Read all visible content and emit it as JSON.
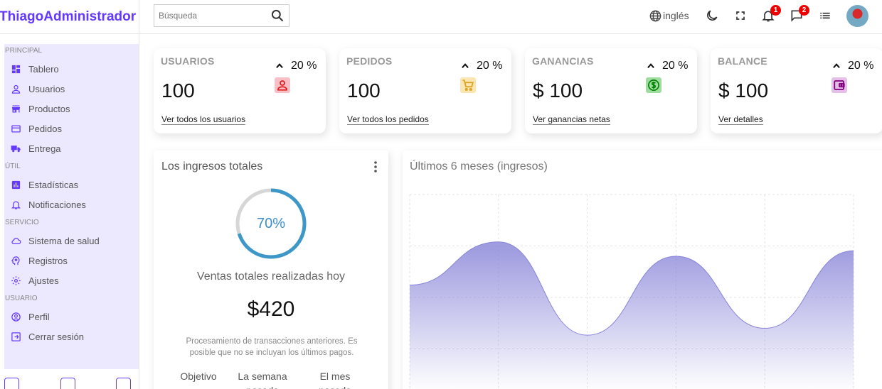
{
  "app": {
    "logo": "ThiagoAdministrador"
  },
  "search": {
    "placeholder": "Búsqueda"
  },
  "topbar": {
    "language": "inglés",
    "notifications_count": "1",
    "messages_count": "2"
  },
  "sidebar": {
    "sections": [
      {
        "title": "PRINCIPAL",
        "items": [
          {
            "label": "Tablero",
            "icon": "dashboard-icon"
          },
          {
            "label": "Usuarios",
            "icon": "user-icon"
          },
          {
            "label": "Productos",
            "icon": "store-icon"
          },
          {
            "label": "Pedidos",
            "icon": "credit-card-icon"
          },
          {
            "label": "Entrega",
            "icon": "truck-icon"
          }
        ]
      },
      {
        "title": "ÚTIL",
        "items": [
          {
            "label": "Estadísticas",
            "icon": "bar-chart-icon"
          },
          {
            "label": "Notificaciones",
            "icon": "bell-icon"
          }
        ]
      },
      {
        "title": "SERVICIO",
        "items": [
          {
            "label": "Sistema de salud",
            "icon": "cloud-icon"
          },
          {
            "label": "Registros",
            "icon": "psychology-icon"
          },
          {
            "label": "Ajustes",
            "icon": "settings-icon"
          }
        ]
      },
      {
        "title": "USUARIO",
        "items": [
          {
            "label": "Perfil",
            "icon": "account-circle-icon"
          },
          {
            "label": "Cerrar sesión",
            "icon": "logout-icon"
          }
        ]
      }
    ],
    "color_options": [
      "#f6f6fb",
      "#333333",
      "#00008b"
    ]
  },
  "widgets": [
    {
      "title": "USUARIOS",
      "value": "100",
      "link": "Ver todos los usuarios",
      "percent": "20 %",
      "icon": "user-icon",
      "icon_color": "#e02020",
      "icon_bg": "#f8c0c6"
    },
    {
      "title": "PEDIDOS",
      "value": "100",
      "link": "Ver todos los pedidos",
      "percent": "20 %",
      "icon": "cart-icon",
      "icon_color": "#daa520",
      "icon_bg": "#fbe5b2"
    },
    {
      "title": "GANANCIAS",
      "value": "$ 100",
      "link": "Ver ganancias netas",
      "percent": "20 %",
      "icon": "dollar-icon",
      "icon_color": "#008000",
      "icon_bg": "#9fdc9f"
    },
    {
      "title": "BALANCE",
      "value": "$ 100",
      "link": "Ver detalles",
      "percent": "20 %",
      "icon": "wallet-icon",
      "icon_color": "#800080",
      "icon_bg": "#e6bfe6"
    }
  ],
  "featured": {
    "title": "Los ingresos totales",
    "progress_percent": 70,
    "progress_label": "70%",
    "subtitle": "Ventas totales realizadas hoy",
    "amount": "$420",
    "description": "Procesamiento de transacciones anteriores. Es posible que no se incluyan los últimos pagos.",
    "summary": [
      "Objetivo",
      "La semana pasada",
      "El mes pasado"
    ]
  },
  "chart_data": {
    "type": "area",
    "title": "Últimos 6 meses (ingresos)",
    "x": [
      "",
      "",
      "",
      "",
      "",
      ""
    ],
    "series": [
      {
        "values": [
          1680,
          2310,
          950,
          2100,
          1050,
          2180
        ]
      }
    ],
    "ylim": [
      0,
      3000
    ],
    "grid": true,
    "color": "#8884d8"
  }
}
